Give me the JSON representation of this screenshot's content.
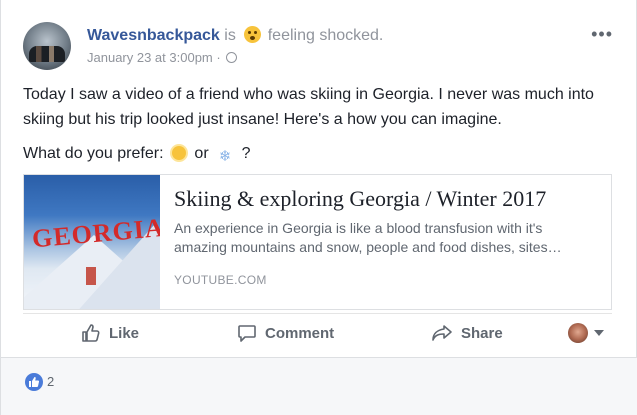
{
  "post": {
    "author": "Wavesnbackpack",
    "is_word": "is",
    "feeling_text": "feeling shocked.",
    "timestamp": "January 23 at 3:00pm",
    "separator": "·",
    "more_label": "•••",
    "body_line1": "Today I saw a video of a friend who was skiing in Georgia. I never was much into skiing but his trip looked just insane! Here's a how you can imagine.",
    "body_line2_prefix": "What do you prefer:",
    "body_line2_or": "or",
    "body_line2_suffix": "?"
  },
  "link_preview": {
    "thumb_title": "GEORGIA",
    "title": "Skiing & exploring Georgia / Winter 2017",
    "description": "An experience in Georgia is like a blood transfusion with it's amazing mountains and snow, people and food dishes, sites…",
    "domain": "YOUTUBE.COM"
  },
  "actions": {
    "like": "Like",
    "comment": "Comment",
    "share": "Share"
  },
  "reactions": {
    "count": "2"
  },
  "colors": {
    "name_link": "#365899",
    "meta_gray": "#90949c",
    "action_gray": "#606770",
    "like_blue": "#4a7bd9"
  }
}
